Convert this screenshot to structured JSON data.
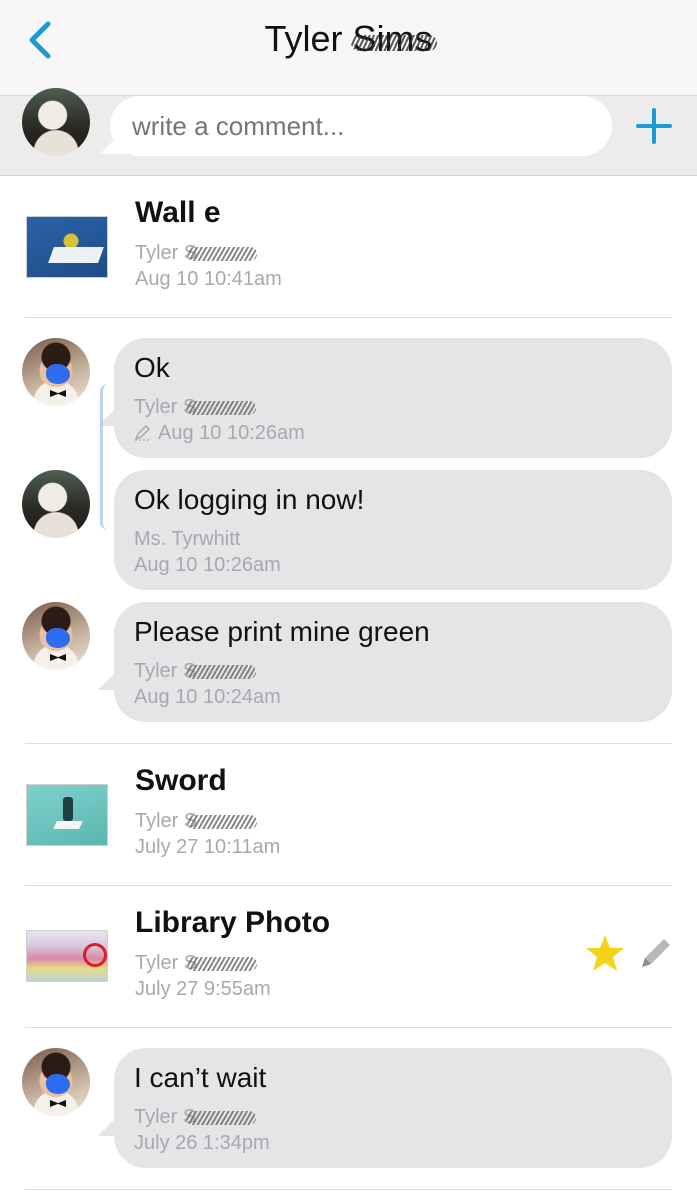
{
  "header": {
    "back_icon": "chevron-left-icon",
    "title_first": "Tyler",
    "title_last": "Sims",
    "accent_color": "#1a9bd6"
  },
  "comment_bar": {
    "placeholder": "write a comment...",
    "add_icon": "plus-icon"
  },
  "items": [
    {
      "type": "file",
      "title": "Wall e",
      "author": "Tyler S",
      "date": "Aug 10 10:41am"
    },
    {
      "type": "message",
      "text": "Ok",
      "author": "Tyler S",
      "date": "Aug 10 10:26am",
      "edited": true
    },
    {
      "type": "message",
      "text": "Ok logging in now!",
      "author": "Ms. Tyrwhitt",
      "date": "Aug 10 10:26am"
    },
    {
      "type": "message",
      "text": "Please print mine green",
      "author": "Tyler S",
      "date": "Aug 10 10:24am"
    },
    {
      "type": "file",
      "title": "Sword",
      "author": "Tyler S",
      "date": "July 27 10:11am"
    },
    {
      "type": "file",
      "title": "Library Photo",
      "author": "Tyler S",
      "date": "July 27 9:55am",
      "starred": true,
      "star_color": "#f5d31a"
    },
    {
      "type": "message",
      "text": "I can’t wait",
      "author": "Tyler S",
      "date": "July 26 1:34pm"
    }
  ]
}
